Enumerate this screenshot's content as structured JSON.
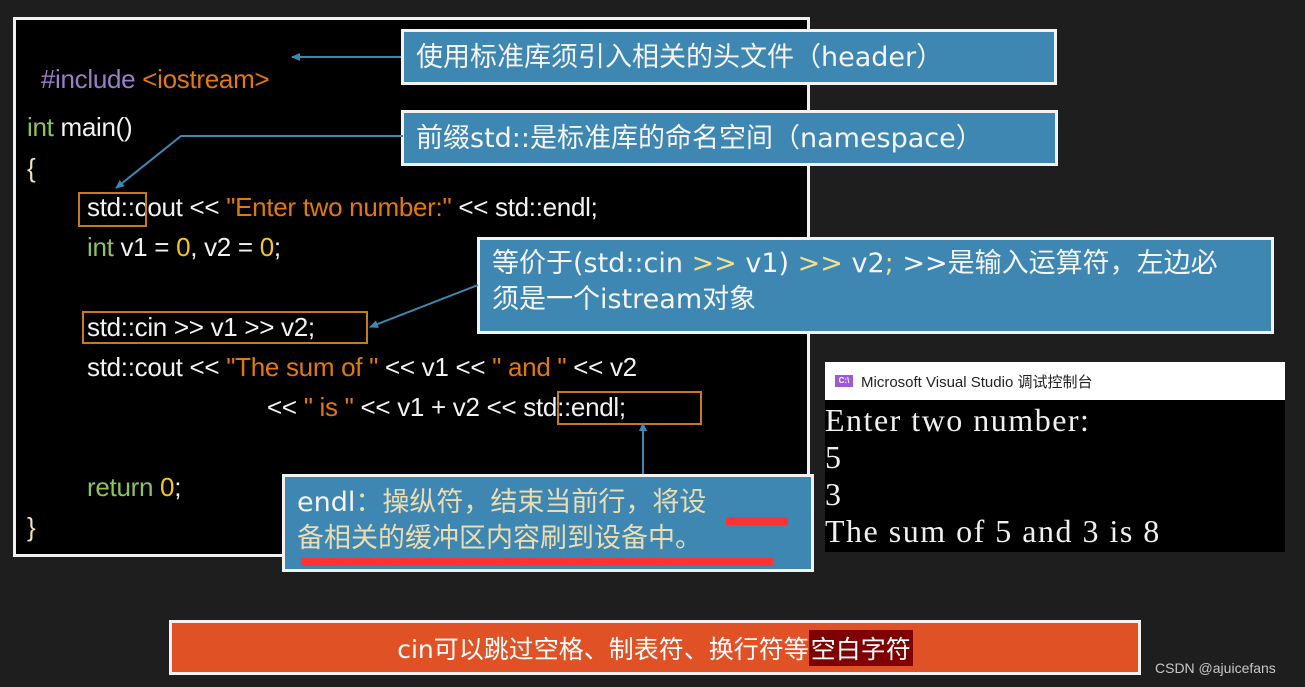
{
  "code": {
    "include": {
      "directive": "#include",
      "header": "<iostream>"
    },
    "main_sig": {
      "type": "int",
      "rest": " main()"
    },
    "open_brace": "{",
    "cout_line": {
      "prefix": "std::",
      "rest": "cout << ",
      "string": "\"Enter two number:\"",
      "tail": " << std::endl;"
    },
    "decl_line": {
      "type": "int",
      "a": " v1 = ",
      "zero1": "0",
      "b": ", v2 = ",
      "zero2": "0",
      "c": ";"
    },
    "cin_line": "std::cin >> v1 >> v2;",
    "sum_line1": {
      "a": "std::cout << ",
      "s1": "\"The sum of \"",
      "b": " << v1 << ",
      "s2": "\" and \"",
      "c": " << v2"
    },
    "sum_line2": {
      "a": "<< ",
      "s1": "\" is \"",
      "b": " << v1 + v2 << ",
      "endl": "std::endl;"
    },
    "return_line": {
      "kw": "return ",
      "zero": "0",
      "semi": ";"
    },
    "close_brace": "}"
  },
  "callouts": {
    "header": "使用标准库须引入相关的头文件（header）",
    "namespace": "前缀std::是标准库的命名空间（namespace）",
    "cin": {
      "line1_a": "等价于(std::cin ",
      "line1_op1": ">>",
      "line1_b": " v1) ",
      "line1_op2": ">>",
      "line1_c": " v2",
      "line1_semi": ";",
      "line1_d": "  >>是输入运算符，左边必",
      "line2": "须是一个istream对象"
    },
    "endl": {
      "label": "endl",
      "line1": "：操纵符，结束当前行，将设",
      "line2": "备相关的缓冲区内容刷到设备中。"
    }
  },
  "console": {
    "title": "Microsoft Visual Studio 调试控制台",
    "icon": "C:\\",
    "lines": [
      "Enter two number:",
      "5",
      "3",
      "The sum of 5 and 3 is 8"
    ]
  },
  "banner": {
    "text": "cin可以跳过空格、制表符、换行符等",
    "highlight": "空白字符"
  },
  "watermark": "CSDN @ajuicefans",
  "colors": {
    "callout_bg": "#3f87b3",
    "banner_bg": "#e05226",
    "highlight_box": "#c87a1e",
    "string": "#e2780e",
    "number": "#f6c71a",
    "keyword_green": "#8fc15b",
    "directive": "#9b7ec8",
    "underline": "#ff3333"
  }
}
